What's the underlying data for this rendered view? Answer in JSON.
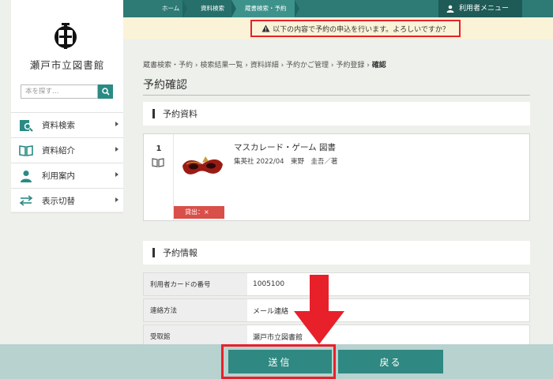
{
  "sidebar": {
    "library_name": "瀬戸市立図書館",
    "search_placeholder": "本を探す…",
    "menu": [
      {
        "label": "資料検索",
        "icon": "search-book-icon"
      },
      {
        "label": "資料紹介",
        "icon": "open-book-icon"
      },
      {
        "label": "利用案内",
        "icon": "person-icon"
      },
      {
        "label": "表示切替",
        "icon": "switch-arrows-icon"
      }
    ]
  },
  "topnav": {
    "crumbs": [
      "ホーム",
      "資料検索",
      "蔵書検索・予約"
    ],
    "user_menu": "利用者メニュー"
  },
  "notice": "以下の内容で予約の申込を行います。よろしいですか？",
  "breadcrumb": [
    "蔵書検索・予約",
    "検索結果一覧",
    "資料詳細",
    "予約かご管理",
    "予約登録",
    "確認"
  ],
  "page_title": "予約確認",
  "section_items": "予約資料",
  "item": {
    "number": "1",
    "title": "マスカレード・ゲーム 図書",
    "meta": "集英社 2022/04　東野　圭吾／著",
    "status": "貸出：×"
  },
  "section_info": "予約情報",
  "info_rows": [
    {
      "label": "利用者カードの番号",
      "value": "1005100"
    },
    {
      "label": "連絡方法",
      "value": "メール連絡"
    },
    {
      "label": "受取館",
      "value": "瀬戸市立図書館"
    }
  ],
  "buttons": {
    "send": "送信",
    "back": "戻る"
  },
  "colors": {
    "accent": "#2f8881",
    "alert": "#e8202a",
    "notice_bg": "#faf3d8",
    "status_bg": "#d94f4a"
  }
}
